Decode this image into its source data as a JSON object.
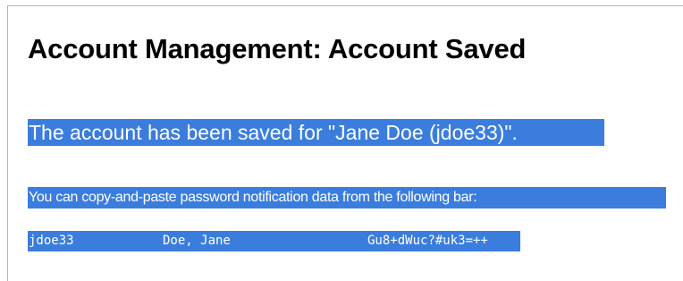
{
  "page": {
    "title": "Account Management: Account Saved",
    "saved_message": "The account has been saved for \"Jane Doe (jdoe33)\".",
    "copy_instruction": "You can copy-and-paste password notification data from the following bar:",
    "notification_bar": {
      "username": "jdoe33",
      "full_name": "Doe, Jane",
      "password": "Gu8+dWuc?#uk3=++"
    }
  },
  "colors": {
    "selection_highlight": "#3b7ddd",
    "frame_border": "#9fb9dc"
  }
}
